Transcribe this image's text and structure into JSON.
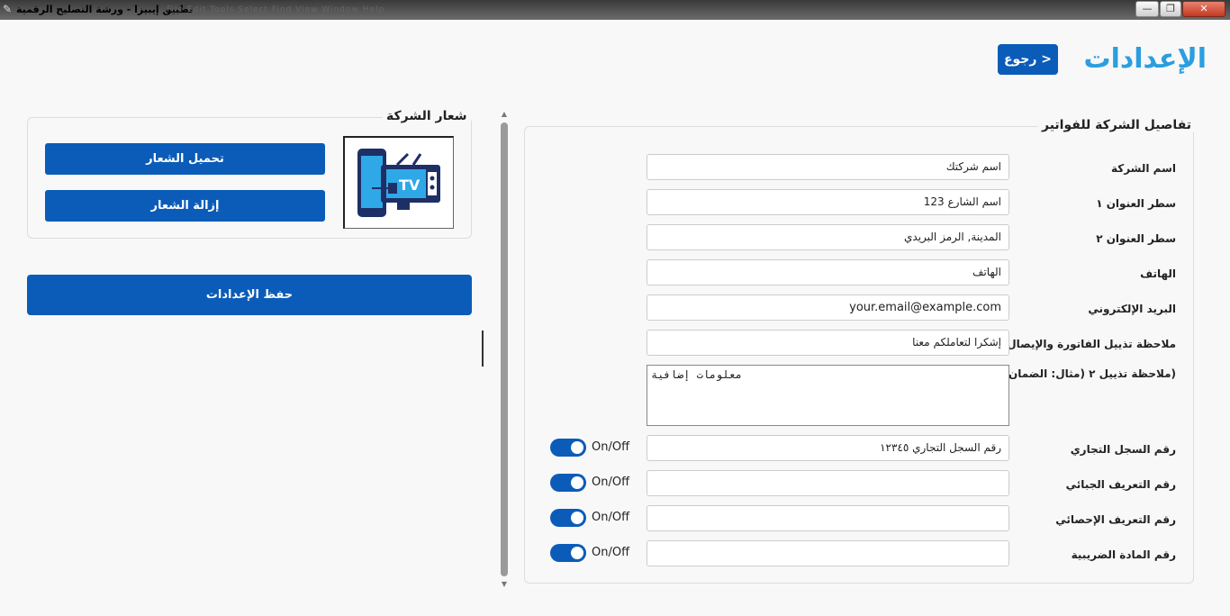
{
  "window": {
    "title": "تطبيق إيبيزا - ورشة التصليح الرقمية",
    "ghost_menu": "File   Edit   Tools   Select   Find   View   Window   Help",
    "min_label": "—",
    "max_label": "❐",
    "close_label": "✕"
  },
  "header": {
    "title": "الإعدادات",
    "back_label": "< رجوع"
  },
  "logo_section": {
    "title": "شعار الشركة",
    "upload_label": "تحميل الشعار",
    "remove_label": "إزالة الشعار",
    "logo_text": "TV"
  },
  "save_label": "حفظ الإعدادات",
  "company": {
    "title": "تفاصيل الشركة للفواتير",
    "fields": [
      {
        "label": "اسم الشركة",
        "value": "اسم شركتك"
      },
      {
        "label": "سطر العنوان ١",
        "value": "اسم الشارع 123"
      },
      {
        "label": "سطر العنوان ٢",
        "value": "المدينة, الرمز البريدي"
      },
      {
        "label": "الهاتف",
        "value": "الهاتف"
      },
      {
        "label": "البريد الإلكتروني",
        "value": "your.email@example.com"
      },
      {
        "label": "ملاحظة تذييل الفاتورة والإيصال",
        "value": "إشكرا لتعاملكم معنا"
      },
      {
        "label": "(ملاحظة تذييل ٢ (مثال: الضمان",
        "value": "معلومات إضافية"
      },
      {
        "label": "رقم السجل التجاري",
        "value": "رقم السجل التجاري ١٢٣٤٥",
        "toggle": "On/Off"
      },
      {
        "label": "رقم التعريف الجبائي",
        "value": "",
        "toggle": "On/Off"
      },
      {
        "label": "رقم التعريف الإحصائي",
        "value": "",
        "toggle": "On/Off"
      },
      {
        "label": "رقم المادة الضريبية",
        "value": "",
        "toggle": "On/Off"
      }
    ]
  },
  "colors": {
    "accent": "#0b5cb8",
    "title_blue": "#2a9ee0"
  }
}
